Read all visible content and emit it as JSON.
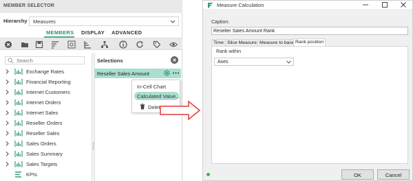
{
  "left_panel": {
    "header": "MEMBER SELECTOR",
    "hierarchy_label": "Hierarchy",
    "hierarchy_value": "Measures",
    "tabs": [
      "MEMBERS",
      "DISPLAY",
      "ADVANCED"
    ],
    "search_placeholder": "Search",
    "members": [
      "Exchange Rates",
      "Financial Reporting",
      "Internet Customers",
      "Internet Orders",
      "Internet Sales",
      "Reseller Orders",
      "Reseller Sales",
      "Sales Orders",
      "Sales Summary",
      "Sales Targets",
      "KPIs"
    ],
    "selections_title": "Selections",
    "selected_item": "Reseller Sales Amount",
    "context_menu": [
      "In-Cell Chart",
      "Calculated Value...",
      "Delete"
    ]
  },
  "dialog": {
    "title": "Measure Calculation",
    "caption_label": "Caption:",
    "caption_value": "Reseller Sales Amount Rank",
    "tabs": [
      "Time",
      "Slice Measure",
      "Measure to base",
      "Rank position"
    ],
    "rank_within_label": "Rank within",
    "rank_within_value": "Axes",
    "ok_label": "OK",
    "cancel_label": "Cancel"
  },
  "colors": {
    "accent": "#4caf8a",
    "selection_bg": "#a9ded0",
    "arrow": "#e53935",
    "status_dot": "#4caf50"
  }
}
